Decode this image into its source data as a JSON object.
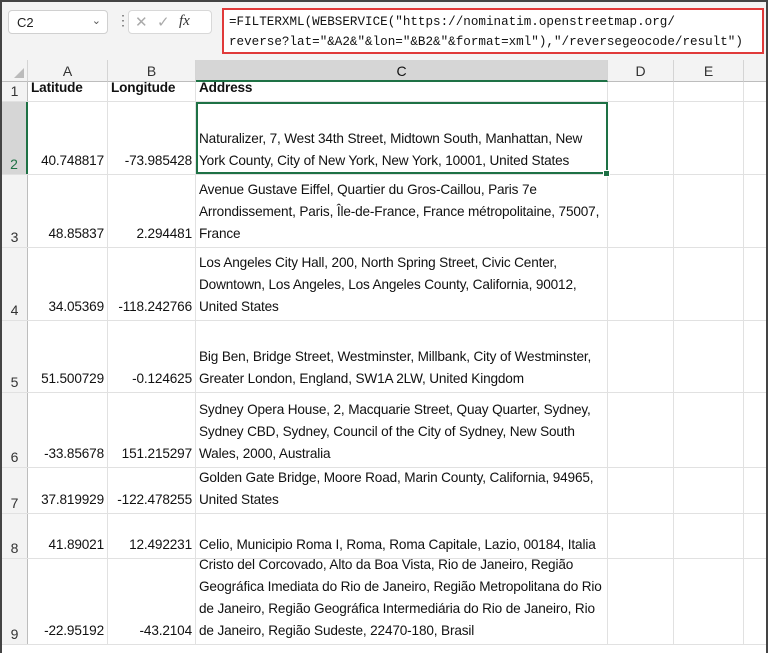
{
  "formula_bar": {
    "name_box": "C2",
    "formula_line1": "=FILTERXML(WEBSERVICE(\"https://nominatim.openstreetmap.org/",
    "formula_line2": "reverse?lat=\"&A2&\"&lon=\"&B2&\"&format=xml\"),\"/reversegeocode/result\")",
    "cancel_icon": "✕",
    "enter_icon": "✓",
    "fx_label": "fx"
  },
  "columns": [
    "A",
    "B",
    "C",
    "D",
    "E"
  ],
  "headers": {
    "row": "1",
    "a": "Latitude",
    "b": "Longitude",
    "c": "Address"
  },
  "rows": [
    {
      "num": "2",
      "lat": "40.748817",
      "lon": "-73.985428",
      "address": "Naturalizer, 7, West 34th Street, Midtown South, Manhattan, New York County, City of New York, New York, 10001, United States"
    },
    {
      "num": "3",
      "lat": "48.85837",
      "lon": "2.294481",
      "address": "Avenue Gustave Eiffel, Quartier du Gros-Caillou, Paris 7e Arrondissement, Paris, Île-de-France, France métropolitaine, 75007, France"
    },
    {
      "num": "4",
      "lat": "34.05369",
      "lon": "-118.242766",
      "address": "Los Angeles City Hall, 200, North Spring Street, Civic Center, Downtown, Los Angeles, Los Angeles County, California, 90012, United States"
    },
    {
      "num": "5",
      "lat": "51.500729",
      "lon": "-0.124625",
      "address": "Big Ben, Bridge Street, Westminster, Millbank, City of Westminster, Greater London, England, SW1A 2LW, United Kingdom"
    },
    {
      "num": "6",
      "lat": "-33.85678",
      "lon": "151.215297",
      "address": "Sydney Opera House, 2, Macquarie Street, Quay Quarter, Sydney, Sydney CBD, Sydney, Council of the City of Sydney, New South Wales, 2000, Australia"
    },
    {
      "num": "7",
      "lat": "37.819929",
      "lon": "-122.478255",
      "address": "Golden Gate Bridge, Moore Road, Marin County, California, 94965, United States"
    },
    {
      "num": "8",
      "lat": "41.89021",
      "lon": "12.492231",
      "address": "Celio, Municipio Roma I, Roma, Roma Capitale, Lazio, 00184, Italia"
    },
    {
      "num": "9",
      "lat": "-22.95192",
      "lon": "-43.2104",
      "address": "Cristo del Corcovado, Alto da Boa Vista, Rio de Janeiro, Região Geográfica Imediata do Rio de Janeiro, Região Metropolitana do Rio de Janeiro, Região Geográfica Intermediária do Rio de Janeiro, Rio de Janeiro, Região Sudeste, 22470-180, Brasil"
    }
  ]
}
